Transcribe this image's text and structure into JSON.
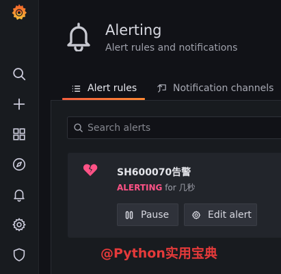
{
  "header": {
    "title": "Alerting",
    "subtitle": "Alert rules and notifications"
  },
  "tabs": [
    {
      "label": "Alert rules",
      "active": true,
      "icon": "list-icon"
    },
    {
      "label": "Notification channels",
      "active": false,
      "icon": "comment-alt-share-icon"
    }
  ],
  "search": {
    "placeholder": "Search alerts",
    "value": ""
  },
  "alert": {
    "name": "SH600070告警",
    "state": "ALERTING",
    "for_text": " for 几秒",
    "icon": "heart-break-icon",
    "state_color": "#ff5286"
  },
  "actions": {
    "pause_label": "Pause",
    "edit_label": "Edit alert"
  },
  "sidebar": {
    "items": [
      "search-icon",
      "plus-icon",
      "apps-icon",
      "compass-icon",
      "bell-icon",
      "cog-icon",
      "shield-icon"
    ]
  },
  "watermark": "@Python实用宝典",
  "colors": {
    "accent": "#f55f3e",
    "background": "#111217",
    "panel": "#181b1f",
    "card": "#22252b"
  }
}
